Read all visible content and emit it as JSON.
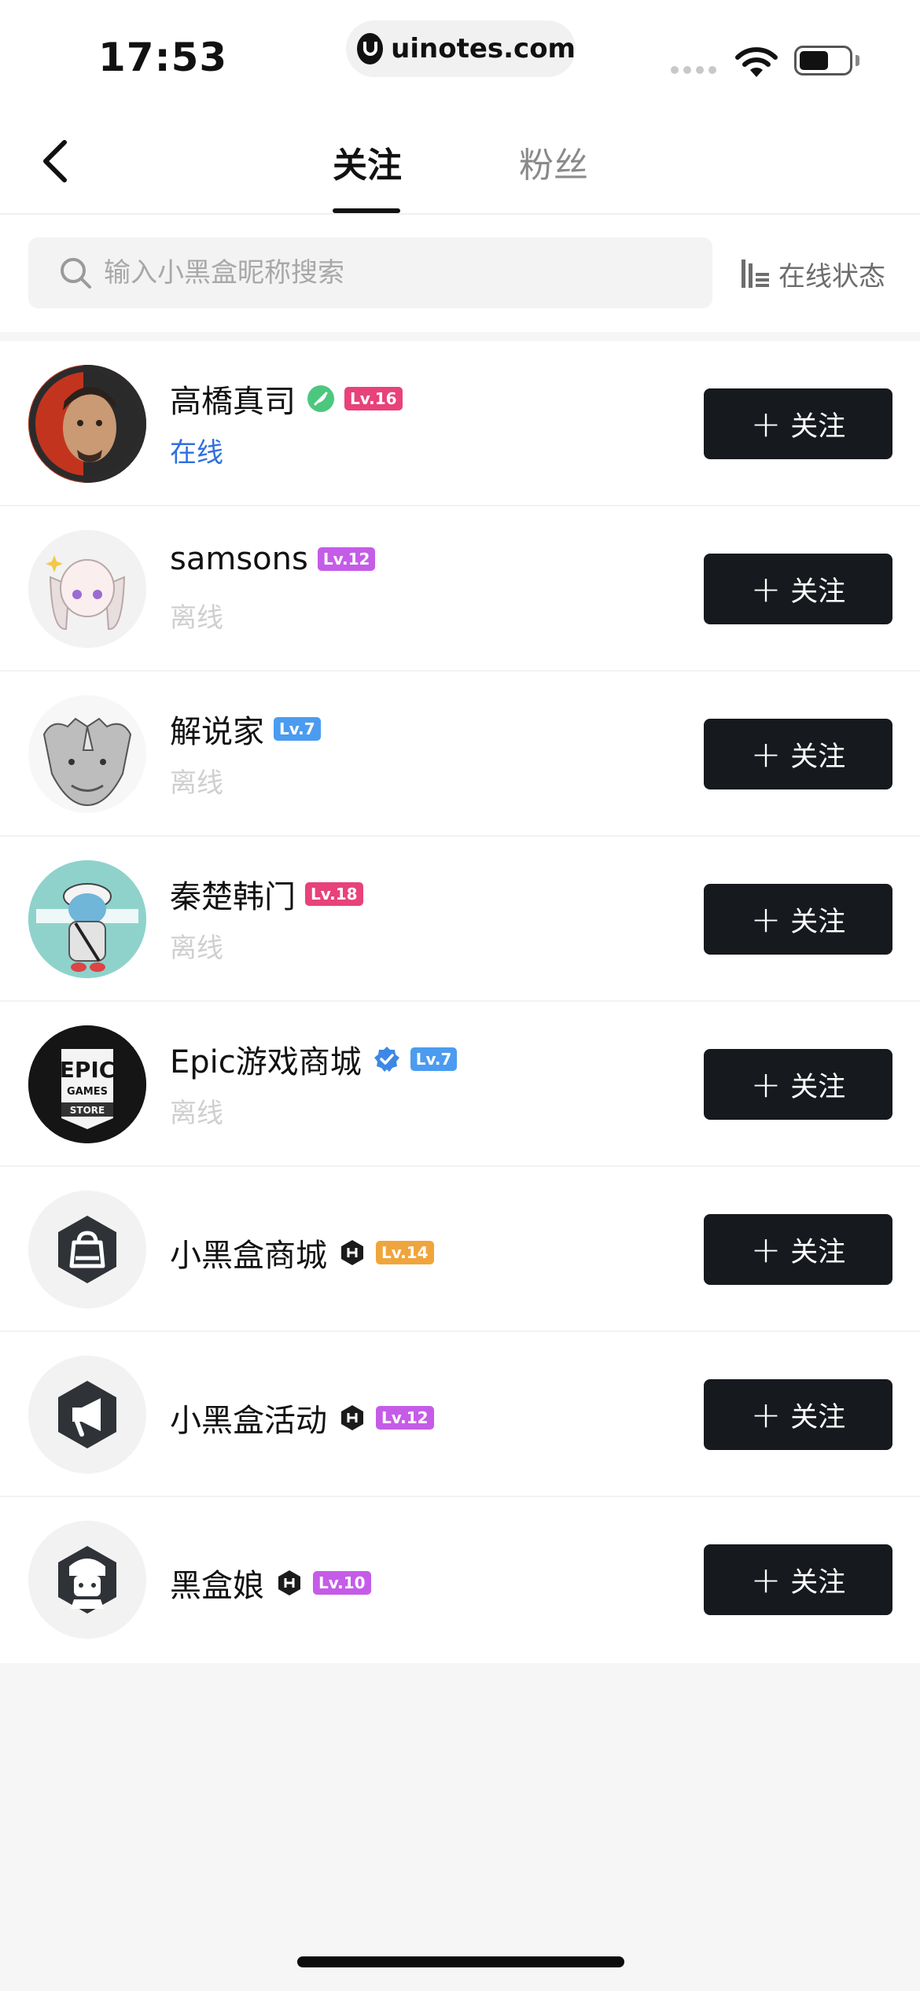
{
  "status_bar": {
    "time": "17:53",
    "url": "uinotes.com"
  },
  "header": {
    "tabs": [
      {
        "label": "关注",
        "active": true
      },
      {
        "label": "粉丝",
        "active": false
      }
    ]
  },
  "search": {
    "placeholder": "输入小黑盒昵称搜索",
    "value": "",
    "online_status_label": "在线状态"
  },
  "colors": {
    "online": "#2f6fdf",
    "offline": "#cfcfcf",
    "button_bg": "#16191d"
  },
  "users": [
    {
      "name": "高橋真司",
      "badge": "green-quill-badge-icon",
      "level": "Lv.16",
      "level_color": "#e8427a",
      "status": "在线",
      "online": true,
      "follow_label": "关注"
    },
    {
      "name": "samsons",
      "badge": "",
      "level": "Lv.12",
      "level_color": "#c55ce8",
      "status": "离线",
      "online": false,
      "follow_label": "关注"
    },
    {
      "name": "解说家",
      "badge": "",
      "level": "Lv.7",
      "level_color": "#4b9cf0",
      "status": "离线",
      "online": false,
      "follow_label": "关注"
    },
    {
      "name": "秦楚韩门",
      "badge": "",
      "level": "Lv.18",
      "level_color": "#e8427a",
      "status": "离线",
      "online": false,
      "follow_label": "关注"
    },
    {
      "name": "Epic游戏商城",
      "badge": "blue-verified-badge-icon",
      "level": "Lv.7",
      "level_color": "#4b9cf0",
      "status": "离线",
      "online": false,
      "follow_label": "关注"
    },
    {
      "name": "小黑盒商城",
      "badge": "heybox-official-badge-icon",
      "level": "Lv.14",
      "level_color": "#f0a53c",
      "status": "",
      "online": false,
      "follow_label": "关注"
    },
    {
      "name": "小黑盒活动",
      "badge": "heybox-official-badge-icon",
      "level": "Lv.12",
      "level_color": "#c55ce8",
      "status": "",
      "online": false,
      "follow_label": "关注"
    },
    {
      "name": "黑盒娘",
      "badge": "heybox-official-badge-icon",
      "level": "Lv.10",
      "level_color": "#c55ce8",
      "status": "",
      "online": false,
      "follow_label": "关注"
    }
  ]
}
